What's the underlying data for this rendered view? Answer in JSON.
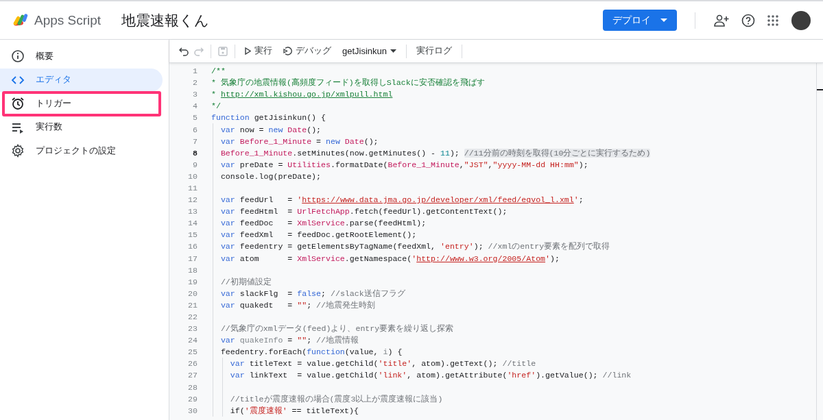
{
  "header": {
    "product": "Apps Script",
    "project_title": "地震速報くん",
    "deploy_button": "デプロイ"
  },
  "sidebar": {
    "items": [
      {
        "label": "概要",
        "selected": false,
        "annotated": false
      },
      {
        "label": "エディタ",
        "selected": true,
        "annotated": false
      },
      {
        "label": "トリガー",
        "selected": false,
        "annotated": true
      },
      {
        "label": "実行数",
        "selected": false,
        "annotated": false
      },
      {
        "label": "プロジェクトの設定",
        "selected": false,
        "annotated": false
      }
    ]
  },
  "toolbar": {
    "undo": {
      "disabled": false
    },
    "redo": {
      "disabled": true
    },
    "save": {
      "disabled": true
    },
    "run": "実行",
    "debug": "デバッグ",
    "function_select": "getJisinkun",
    "log": "実行ログ"
  },
  "editor": {
    "lines": [
      {
        "number": "1",
        "current": false,
        "tokens": [
          {
            "kind": "doc",
            "text": "/**"
          }
        ]
      },
      {
        "number": "2",
        "current": false,
        "tokens": [
          {
            "kind": "doc",
            "text": "* 気象庁の地震情報(高頻度フィード)を取得しSlackに安否確認を飛ばす"
          }
        ]
      },
      {
        "number": "3",
        "current": false,
        "tokens": [
          {
            "kind": "doc",
            "text": "* "
          },
          {
            "kind": "doclink",
            "text": "http://xml.kishou.go.jp/xmlpull.html"
          }
        ]
      },
      {
        "number": "4",
        "current": false,
        "tokens": [
          {
            "kind": "doc",
            "text": "*/"
          }
        ]
      },
      {
        "number": "5",
        "current": false,
        "tokens": [
          {
            "kind": "kw",
            "text": "function"
          },
          {
            "kind": "p",
            "text": " getJisinkun() {"
          }
        ]
      },
      {
        "number": "6",
        "current": false,
        "tokens": [
          {
            "kind": "kw",
            "text": "  var"
          },
          {
            "kind": "p",
            "text": " now = "
          },
          {
            "kind": "kw",
            "text": "new"
          },
          {
            "kind": "id",
            "text": " Date"
          },
          {
            "kind": "p",
            "text": "();"
          }
        ]
      },
      {
        "number": "7",
        "current": false,
        "tokens": [
          {
            "kind": "kw",
            "text": "  var"
          },
          {
            "kind": "id",
            "text": " Before_1_Minute"
          },
          {
            "kind": "p",
            "text": " = "
          },
          {
            "kind": "kw",
            "text": "new"
          },
          {
            "kind": "id",
            "text": " Date"
          },
          {
            "kind": "p",
            "text": "();"
          }
        ]
      },
      {
        "number": "8",
        "current": true,
        "tokens": [
          {
            "kind": "id",
            "text": "  Before_1_Minute"
          },
          {
            "kind": "p",
            "text": ".setMinutes(now.getMinutes() - "
          },
          {
            "kind": "num",
            "text": "11"
          },
          {
            "kind": "p",
            "text": "); "
          },
          {
            "kind": "cmhl",
            "text": "//11分前の時刻を取得(10分ごとに実行するため)"
          }
        ]
      },
      {
        "number": "9",
        "current": false,
        "tokens": [
          {
            "kind": "kw",
            "text": "  var"
          },
          {
            "kind": "p",
            "text": " preDate = "
          },
          {
            "kind": "id",
            "text": "Utilities"
          },
          {
            "kind": "p",
            "text": ".formatDate("
          },
          {
            "kind": "id",
            "text": "Before_1_Minute"
          },
          {
            "kind": "p",
            "text": ","
          },
          {
            "kind": "str",
            "text": "\"JST\""
          },
          {
            "kind": "p",
            "text": ","
          },
          {
            "kind": "str",
            "text": "\"yyyy-MM-dd HH:mm\""
          },
          {
            "kind": "p",
            "text": ");"
          }
        ]
      },
      {
        "number": "10",
        "current": false,
        "tokens": [
          {
            "kind": "p",
            "text": "  console.log(preDate);"
          }
        ]
      },
      {
        "number": "11",
        "current": false
      },
      {
        "number": "12",
        "current": false,
        "tokens": [
          {
            "kind": "kw",
            "text": "  var"
          },
          {
            "kind": "p",
            "text": " feedUrl   = "
          },
          {
            "kind": "str",
            "text": "'"
          },
          {
            "kind": "strlink",
            "text": "https://www.data.jma.go.jp/developer/xml/feed/eqvol_l.xml"
          },
          {
            "kind": "str",
            "text": "'"
          },
          {
            "kind": "p",
            "text": ";"
          }
        ]
      },
      {
        "number": "13",
        "current": false,
        "tokens": [
          {
            "kind": "kw",
            "text": "  var"
          },
          {
            "kind": "p",
            "text": " feedHtml  = "
          },
          {
            "kind": "id",
            "text": "UrlFetchApp"
          },
          {
            "kind": "p",
            "text": ".fetch(feedUrl).getContentText();"
          }
        ]
      },
      {
        "number": "14",
        "current": false,
        "tokens": [
          {
            "kind": "kw",
            "text": "  var"
          },
          {
            "kind": "p",
            "text": " feedDoc   = "
          },
          {
            "kind": "id",
            "text": "XmlService"
          },
          {
            "kind": "p",
            "text": ".parse(feedHtml);"
          }
        ]
      },
      {
        "number": "15",
        "current": false,
        "tokens": [
          {
            "kind": "kw",
            "text": "  var"
          },
          {
            "kind": "p",
            "text": " feedXml   = feedDoc.getRootElement();"
          }
        ]
      },
      {
        "number": "16",
        "current": false,
        "tokens": [
          {
            "kind": "kw",
            "text": "  var"
          },
          {
            "kind": "p",
            "text": " feedentry = getElementsByTagName(feedXml, "
          },
          {
            "kind": "str",
            "text": "'entry'"
          },
          {
            "kind": "p",
            "text": "); "
          },
          {
            "kind": "cm",
            "text": "//xmlのentry要素を配列で取得"
          }
        ]
      },
      {
        "number": "17",
        "current": false,
        "tokens": [
          {
            "kind": "kw",
            "text": "  var"
          },
          {
            "kind": "p",
            "text": " atom      = "
          },
          {
            "kind": "id",
            "text": "XmlService"
          },
          {
            "kind": "p",
            "text": ".getNamespace("
          },
          {
            "kind": "str",
            "text": "'"
          },
          {
            "kind": "strlink",
            "text": "http://www.w3.org/2005/Atom"
          },
          {
            "kind": "str",
            "text": "'"
          },
          {
            "kind": "p",
            "text": ");"
          }
        ]
      },
      {
        "number": "18",
        "current": false
      },
      {
        "number": "19",
        "current": false,
        "tokens": [
          {
            "kind": "cm",
            "text": "  //初期値設定"
          }
        ]
      },
      {
        "number": "20",
        "current": false,
        "tokens": [
          {
            "kind": "kw",
            "text": "  var"
          },
          {
            "kind": "p",
            "text": " slackFlg  = "
          },
          {
            "kind": "kw",
            "text": "false"
          },
          {
            "kind": "p",
            "text": "; "
          },
          {
            "kind": "cm",
            "text": "//slack送信フラグ"
          }
        ]
      },
      {
        "number": "21",
        "current": false,
        "tokens": [
          {
            "kind": "kw",
            "text": "  var"
          },
          {
            "kind": "p",
            "text": " quakedt   = "
          },
          {
            "kind": "str",
            "text": "\"\""
          },
          {
            "kind": "p",
            "text": "; "
          },
          {
            "kind": "cm",
            "text": "//地震発生時刻"
          }
        ]
      },
      {
        "number": "22",
        "current": false
      },
      {
        "number": "23",
        "current": false,
        "tokens": [
          {
            "kind": "cm",
            "text": "  //気象庁のxmlデータ(feed)より、entry要素を繰り返し探索"
          }
        ]
      },
      {
        "number": "24",
        "current": false,
        "tokens": [
          {
            "kind": "kw",
            "text": "  var"
          },
          {
            "kind": "dim",
            "text": " quakeInfo"
          },
          {
            "kind": "p",
            "text": " = "
          },
          {
            "kind": "str",
            "text": "\"\""
          },
          {
            "kind": "p",
            "text": "; "
          },
          {
            "kind": "cm",
            "text": "//地震情報"
          }
        ]
      },
      {
        "number": "25",
        "current": false,
        "tokens": [
          {
            "kind": "p",
            "text": "  feedentry.forEach("
          },
          {
            "kind": "kw",
            "text": "function"
          },
          {
            "kind": "p",
            "text": "(value, "
          },
          {
            "kind": "dim",
            "text": "i"
          },
          {
            "kind": "p",
            "text": ") {"
          }
        ]
      },
      {
        "number": "26",
        "current": false,
        "tokens": [
          {
            "kind": "kw",
            "text": "    var"
          },
          {
            "kind": "p",
            "text": " titleText = value.getChild("
          },
          {
            "kind": "str",
            "text": "'title'"
          },
          {
            "kind": "p",
            "text": ", atom).getText(); "
          },
          {
            "kind": "cm",
            "text": "//title"
          }
        ]
      },
      {
        "number": "27",
        "current": false,
        "tokens": [
          {
            "kind": "kw",
            "text": "    var"
          },
          {
            "kind": "p",
            "text": " linkText  = value.getChild("
          },
          {
            "kind": "str",
            "text": "'link'"
          },
          {
            "kind": "p",
            "text": ", atom).getAttribute("
          },
          {
            "kind": "str",
            "text": "'href'"
          },
          {
            "kind": "p",
            "text": ").getValue(); "
          },
          {
            "kind": "cm",
            "text": "//link"
          }
        ]
      },
      {
        "number": "28",
        "current": false
      },
      {
        "number": "29",
        "current": false,
        "tokens": [
          {
            "kind": "cm",
            "text": "    //titleが震度速報の場合(震度3以上が震度速報に該当)"
          }
        ]
      },
      {
        "number": "30",
        "current": false,
        "tokens": [
          {
            "kind": "p",
            "text": "    if("
          },
          {
            "kind": "str",
            "text": "'震度速報'"
          },
          {
            "kind": "p",
            "text": " == titleText){"
          }
        ]
      }
    ]
  }
}
